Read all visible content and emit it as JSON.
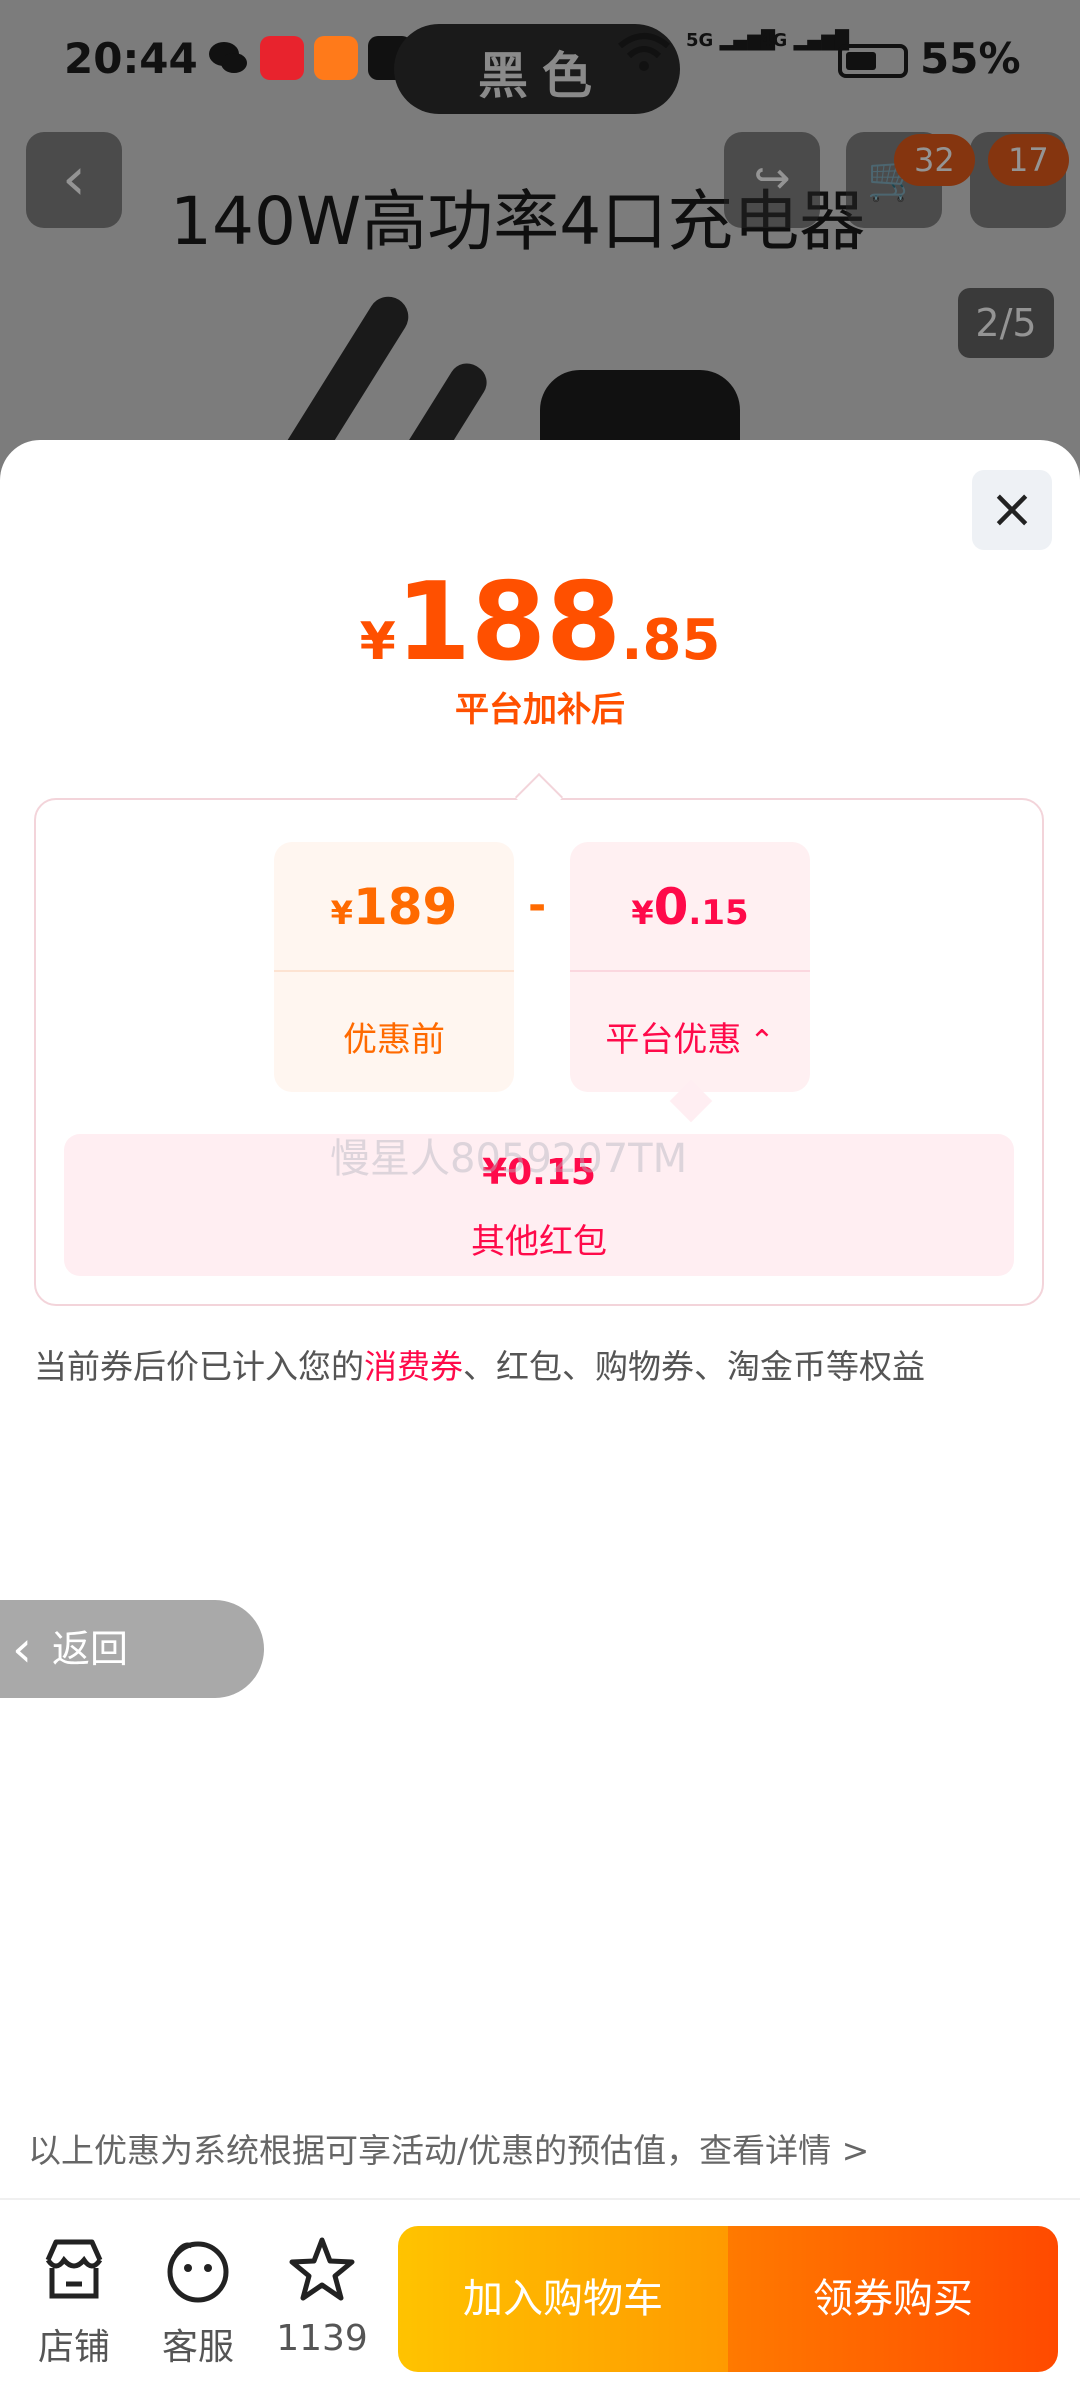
{
  "status_bar": {
    "time": "20:44",
    "center_text": "黑色",
    "network_1": "5G",
    "network_2": "4G",
    "battery": "55%"
  },
  "product_page": {
    "title": "140W高功率4口充电器",
    "image_counter": "2/5",
    "cart_badge": "32",
    "more_badge": "17",
    "icons": [
      "back-icon",
      "share-icon",
      "cart-icon",
      "more-icon"
    ]
  },
  "sheet": {
    "close_icon": "close-icon",
    "final_price": {
      "currency": "¥",
      "integer": "188",
      "decimal": ".85"
    },
    "final_price_label": "平台加补后",
    "original": {
      "currency": "¥",
      "integer": "189",
      "label": "优惠前"
    },
    "minus": "-",
    "platform_discount": {
      "currency": "¥",
      "integer": "0",
      "decimal": ".15",
      "label": "平台优惠"
    },
    "other": {
      "value": "¥0.15",
      "label": "其他红包"
    },
    "watermark": "慢星人8059207TM",
    "note_prefix": "当前券后价已计入您的",
    "note_highlight": "消费券",
    "note_suffix": "、红包、购物券、淘金币等权益",
    "back_label": "返回",
    "disclaimer": "以上优惠为系统根据可享活动/优惠的预估值，查看详情 >"
  },
  "bottom_bar": {
    "shop_label": "店铺",
    "service_label": "客服",
    "favorites_count": "1139",
    "add_to_cart": "加入购物车",
    "buy_now": "领券购买"
  },
  "colors": {
    "accent_orange": "#ff5000",
    "accent_red": "#ff0a4a",
    "cart_button": "#ffb000",
    "buy_button": "#ff5a00"
  }
}
